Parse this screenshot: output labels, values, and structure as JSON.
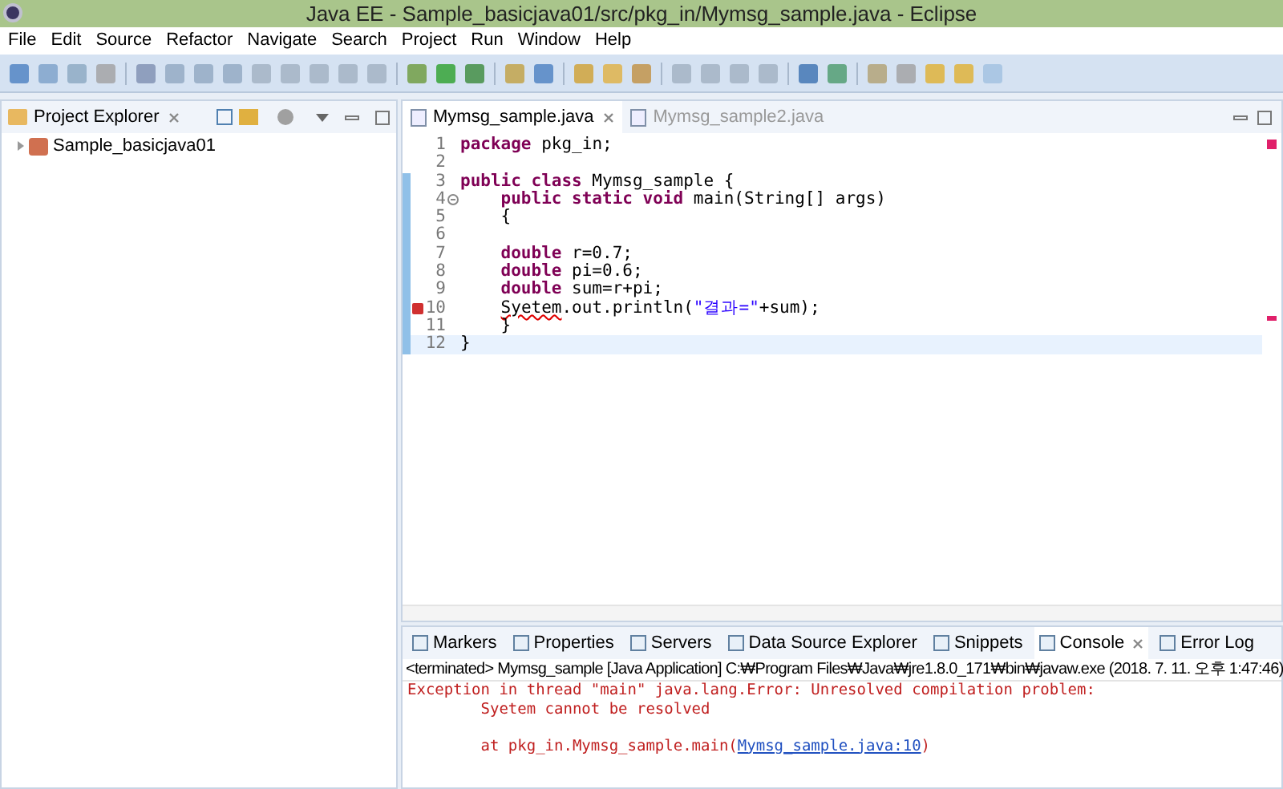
{
  "window": {
    "title": "Java EE - Sample_basicjava01/src/pkg_in/Mymsg_sample.java - Eclipse"
  },
  "menu": [
    "File",
    "Edit",
    "Source",
    "Refactor",
    "Navigate",
    "Search",
    "Project",
    "Run",
    "Window",
    "Help"
  ],
  "project_explorer": {
    "title": "Project Explorer",
    "tree": [
      {
        "label": "Sample_basicjava01",
        "expanded": false
      }
    ]
  },
  "editor": {
    "tabs": [
      {
        "label": "Mymsg_sample.java",
        "selected": true
      },
      {
        "label": "Mymsg_sample2.java",
        "selected": false
      }
    ],
    "lines": [
      {
        "number": "1",
        "foldable": false,
        "has_error": false,
        "current": false,
        "changed": false,
        "segments": [
          {
            "kind": "keyword",
            "text": "package"
          },
          {
            "kind": "plain",
            "text": " pkg_in;"
          }
        ]
      },
      {
        "number": "2",
        "foldable": false,
        "has_error": false,
        "current": false,
        "changed": false
      },
      {
        "number": "3",
        "foldable": false,
        "has_error": false,
        "current": false,
        "changed": true,
        "segments": [
          {
            "kind": "keyword",
            "text": "public class"
          },
          {
            "kind": "plain",
            "text": " Mymsg_sample {"
          }
        ]
      },
      {
        "number": "4",
        "foldable": true,
        "has_error": false,
        "current": false,
        "changed": true,
        "segments": [
          {
            "kind": "keyword",
            "text": "    public static void"
          },
          {
            "kind": "plain",
            "text": " main(String[] args)"
          }
        ]
      },
      {
        "number": "5",
        "foldable": false,
        "has_error": false,
        "current": false,
        "changed": true,
        "segments": [
          {
            "kind": "plain",
            "text": "    {"
          }
        ]
      },
      {
        "number": "6",
        "foldable": false,
        "has_error": false,
        "current": false,
        "changed": true
      },
      {
        "number": "7",
        "foldable": false,
        "has_error": false,
        "current": false,
        "changed": true,
        "segments": [
          {
            "kind": "keyword",
            "text": "    double"
          },
          {
            "kind": "plain",
            "text": " r=0.7;"
          }
        ]
      },
      {
        "number": "8",
        "foldable": false,
        "has_error": false,
        "current": false,
        "changed": true,
        "segments": [
          {
            "kind": "keyword",
            "text": "    double"
          },
          {
            "kind": "plain",
            "text": " pi=0.6;"
          }
        ]
      },
      {
        "number": "9",
        "foldable": false,
        "has_error": false,
        "current": false,
        "changed": true,
        "segments": [
          {
            "kind": "keyword",
            "text": "    double"
          },
          {
            "kind": "plain",
            "text": " sum=r+pi;"
          }
        ]
      },
      {
        "number": "10",
        "foldable": false,
        "has_error": true,
        "current": false,
        "changed": true,
        "segments": [
          {
            "kind": "error",
            "text": "    Syetem"
          },
          {
            "kind": "plain",
            "text": ".out.println("
          },
          {
            "kind": "string",
            "text": "\"결과=\""
          },
          {
            "kind": "plain",
            "text": "+sum);"
          }
        ]
      },
      {
        "number": "11",
        "foldable": false,
        "has_error": false,
        "current": false,
        "changed": true,
        "segments": [
          {
            "kind": "plain",
            "text": "    }"
          }
        ]
      },
      {
        "number": "12",
        "foldable": false,
        "has_error": false,
        "current": true,
        "changed": true,
        "segments": [
          {
            "kind": "plain",
            "text": "}"
          }
        ]
      }
    ]
  },
  "bottom_panel": {
    "tabs": [
      {
        "label": "Markers",
        "selected": false
      },
      {
        "label": "Properties",
        "selected": false
      },
      {
        "label": "Servers",
        "selected": false
      },
      {
        "label": "Data Source Explorer",
        "selected": false
      },
      {
        "label": "Snippets",
        "selected": false
      },
      {
        "label": "Console",
        "selected": true
      },
      {
        "label": "Error Log",
        "selected": false
      }
    ],
    "status": "<terminated> Mymsg_sample [Java Application] C:₩Program Files₩Java₩jre1.8.0_171₩bin₩javaw.exe (2018. 7. 11. 오후 1:47:46)",
    "output": [
      {
        "kind": "error",
        "text": "Exception in thread \"main\" java.lang.Error: Unresolved compilation problem: "
      },
      {
        "kind": "error",
        "text": "        Syetem cannot be resolved"
      },
      {
        "kind": "blank"
      },
      {
        "kind": "trace",
        "text": "        at pkg_in.Mymsg_sample.main(",
        "link": "Mymsg_sample.java:10",
        "after": ")"
      }
    ]
  }
}
